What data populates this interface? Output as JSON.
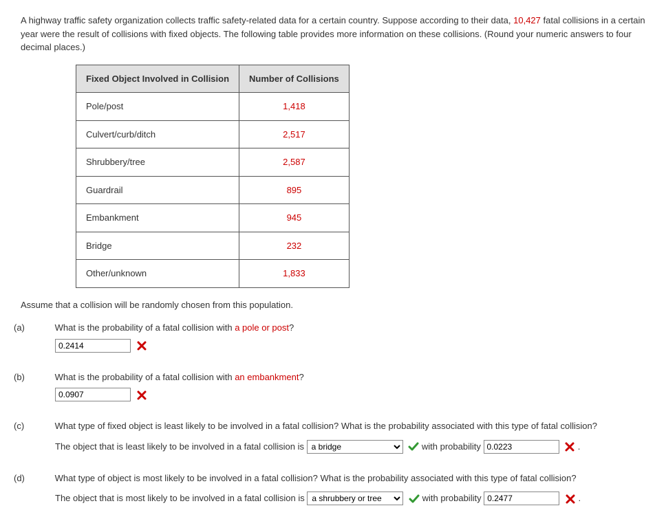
{
  "intro": {
    "text_part1": "A highway traffic safety organization collects traffic safety-related data for a certain country. Suppose according to their data, ",
    "highlight_number": "10,427",
    "text_part2": " fatal collisions in a certain year were the result of collisions with fixed objects. The following table provides more information on these collisions. (Round your numeric answers to four decimal places.)"
  },
  "table": {
    "header1": "Fixed Object Involved in Collision",
    "header2": "Number of Collisions",
    "rows": [
      {
        "label": "Pole/post",
        "value": "1,418"
      },
      {
        "label": "Culvert/curb/ditch",
        "value": "2,517"
      },
      {
        "label": "Shrubbery/tree",
        "value": "2,587"
      },
      {
        "label": "Guardrail",
        "value": "895"
      },
      {
        "label": "Embankment",
        "value": "945"
      },
      {
        "label": "Bridge",
        "value": "232"
      },
      {
        "label": "Other/unknown",
        "value": "1,833"
      }
    ]
  },
  "instructions": "Assume that a collision will be randomly chosen from this population.",
  "qa": {
    "a": {
      "label": "(a)",
      "question_prefix": "What is the probability of a fatal collision with ",
      "question_highlight": "a pole or post",
      "question_suffix": "?",
      "answer": "0.2414"
    },
    "b": {
      "label": "(b)",
      "question_prefix": "What is the probability of a fatal collision with ",
      "question_highlight": "an embankment",
      "question_suffix": "?",
      "answer": "0.0907"
    },
    "c": {
      "label": "(c)",
      "question": "What type of fixed object is least likely to be involved in a fatal collision? What is the probability associated with this type of fatal collision?",
      "sentence_prefix": "The object that is least likely to be involved in a fatal collision is ",
      "select_option": "a bridge",
      "prob_text": " with probability ",
      "prob_value": "0.0223",
      "period": "."
    },
    "d": {
      "label": "(d)",
      "question": "What type of object is most likely to be involved in a fatal collision? What is the probability associated with this type of fatal collision?",
      "sentence_prefix": "The object that is most likely to be involved in a fatal collision is ",
      "select_option": "a shrubbery or tree",
      "prob_text": " with probability ",
      "prob_value": "0.2477",
      "period": "."
    }
  }
}
